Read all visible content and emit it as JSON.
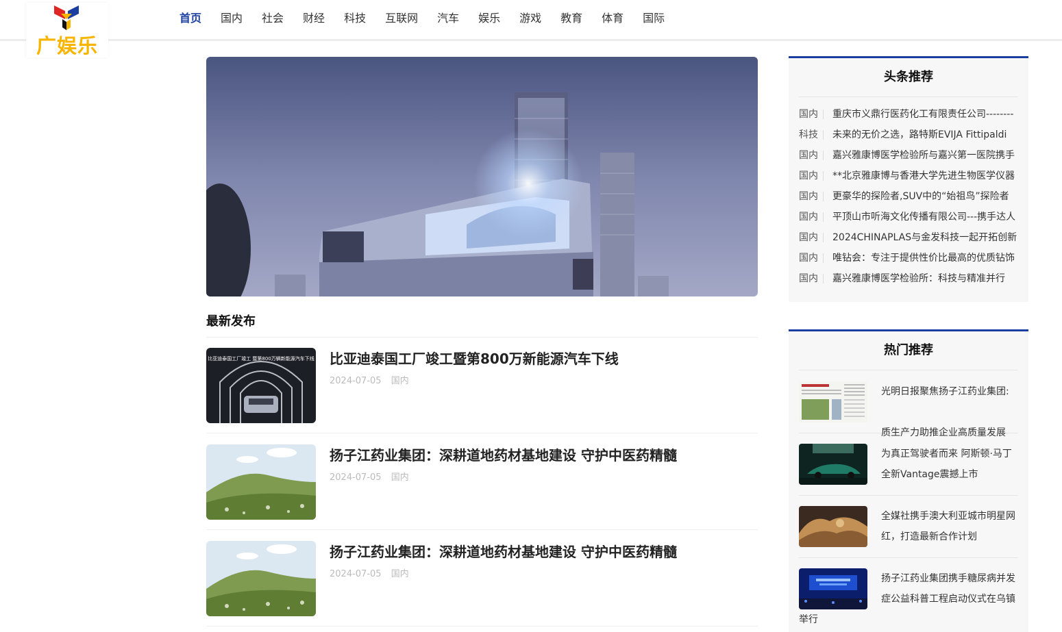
{
  "header": {
    "logo_text": "广娱乐",
    "nav": [
      {
        "label": "首页",
        "active": true
      },
      {
        "label": "国内"
      },
      {
        "label": "社会"
      },
      {
        "label": "财经"
      },
      {
        "label": "科技"
      },
      {
        "label": "互联网"
      },
      {
        "label": "汽车"
      },
      {
        "label": "娱乐"
      },
      {
        "label": "游戏"
      },
      {
        "label": "教育"
      },
      {
        "label": "体育"
      },
      {
        "label": "国际"
      }
    ]
  },
  "latest": {
    "title": "最新发布",
    "items": [
      {
        "title": "比亚迪泰国工厂竣工暨第800万新能源汽车下线",
        "date": "2024-07-05",
        "category": "国内",
        "thumb_caption": "比亚迪泰国工厂竣工 暨第800万辆新能源汽车下线"
      },
      {
        "title": "扬子江药业集团：深耕道地药材基地建设 守护中医药精髓",
        "date": "2024-07-05",
        "category": "国内"
      },
      {
        "title": "扬子江药业集团：深耕道地药材基地建设 守护中医药精髓",
        "date": "2024-07-05",
        "category": "国内"
      }
    ]
  },
  "sidebar": {
    "top": {
      "title": "头条推荐",
      "items": [
        {
          "cat": "国内",
          "title": "重庆市义鼎行医药化工有限责任公司--------"
        },
        {
          "cat": "科技",
          "title": "未来的无价之选，路特斯EVIJA Fittipaldi"
        },
        {
          "cat": "国内",
          "title": "嘉兴雅康博医学检验所与嘉兴第一医院携手"
        },
        {
          "cat": "国内",
          "title": "**北京雅康博与香港大学先进生物医学仪器"
        },
        {
          "cat": "国内",
          "title": "更豪华的探险者,SUV中的“始祖鸟”探险者"
        },
        {
          "cat": "国内",
          "title": "平顶山市听海文化传播有限公司---携手达人"
        },
        {
          "cat": "国内",
          "title": "2024CHINAPLAS与金发科技一起开拓创新"
        },
        {
          "cat": "国内",
          "title": "唯钻会：专注于提供性价比最高的优质钻饰"
        },
        {
          "cat": "国内",
          "title": "嘉兴雅康博医学检验所：科技与精准并行"
        }
      ]
    },
    "hot": {
      "title": "热门推荐",
      "items": [
        {
          "line1": "光明日报聚焦扬子江药业集团:新",
          "line2": "质生产力助推企业高质量发展"
        },
        {
          "line1": "为真正驾驶者而来 阿斯顿·马丁",
          "line2": "全新Vantage震撼上市"
        },
        {
          "line1": "全媒社携手澳大利亚城市明星网",
          "line2": "红，打造最新合作计划"
        },
        {
          "line1": "扬子江药业集团携手糖尿病并发",
          "line2": "症公益科普工程启动仪式在乌镇",
          "line3": "举行"
        }
      ]
    }
  },
  "colors": {
    "accent": "#1a3fa0",
    "logo": "#f7b500"
  }
}
